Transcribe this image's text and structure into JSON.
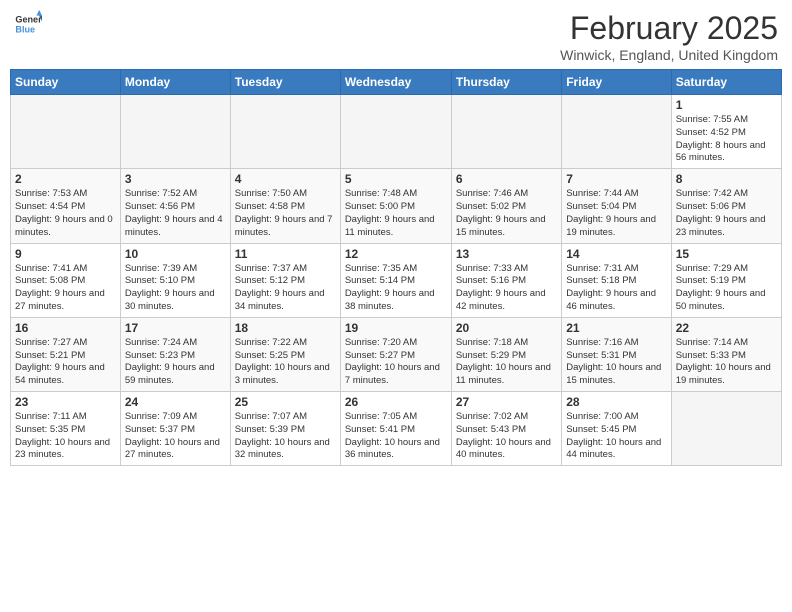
{
  "header": {
    "logo_line1": "General",
    "logo_line2": "Blue",
    "month_year": "February 2025",
    "location": "Winwick, England, United Kingdom"
  },
  "weekdays": [
    "Sunday",
    "Monday",
    "Tuesday",
    "Wednesday",
    "Thursday",
    "Friday",
    "Saturday"
  ],
  "weeks": [
    [
      {
        "day": "",
        "info": ""
      },
      {
        "day": "",
        "info": ""
      },
      {
        "day": "",
        "info": ""
      },
      {
        "day": "",
        "info": ""
      },
      {
        "day": "",
        "info": ""
      },
      {
        "day": "",
        "info": ""
      },
      {
        "day": "1",
        "info": "Sunrise: 7:55 AM\nSunset: 4:52 PM\nDaylight: 8 hours\nand 56 minutes."
      }
    ],
    [
      {
        "day": "2",
        "info": "Sunrise: 7:53 AM\nSunset: 4:54 PM\nDaylight: 9 hours\nand 0 minutes."
      },
      {
        "day": "3",
        "info": "Sunrise: 7:52 AM\nSunset: 4:56 PM\nDaylight: 9 hours\nand 4 minutes."
      },
      {
        "day": "4",
        "info": "Sunrise: 7:50 AM\nSunset: 4:58 PM\nDaylight: 9 hours\nand 7 minutes."
      },
      {
        "day": "5",
        "info": "Sunrise: 7:48 AM\nSunset: 5:00 PM\nDaylight: 9 hours\nand 11 minutes."
      },
      {
        "day": "6",
        "info": "Sunrise: 7:46 AM\nSunset: 5:02 PM\nDaylight: 9 hours\nand 15 minutes."
      },
      {
        "day": "7",
        "info": "Sunrise: 7:44 AM\nSunset: 5:04 PM\nDaylight: 9 hours\nand 19 minutes."
      },
      {
        "day": "8",
        "info": "Sunrise: 7:42 AM\nSunset: 5:06 PM\nDaylight: 9 hours\nand 23 minutes."
      }
    ],
    [
      {
        "day": "9",
        "info": "Sunrise: 7:41 AM\nSunset: 5:08 PM\nDaylight: 9 hours\nand 27 minutes."
      },
      {
        "day": "10",
        "info": "Sunrise: 7:39 AM\nSunset: 5:10 PM\nDaylight: 9 hours\nand 30 minutes."
      },
      {
        "day": "11",
        "info": "Sunrise: 7:37 AM\nSunset: 5:12 PM\nDaylight: 9 hours\nand 34 minutes."
      },
      {
        "day": "12",
        "info": "Sunrise: 7:35 AM\nSunset: 5:14 PM\nDaylight: 9 hours\nand 38 minutes."
      },
      {
        "day": "13",
        "info": "Sunrise: 7:33 AM\nSunset: 5:16 PM\nDaylight: 9 hours\nand 42 minutes."
      },
      {
        "day": "14",
        "info": "Sunrise: 7:31 AM\nSunset: 5:18 PM\nDaylight: 9 hours\nand 46 minutes."
      },
      {
        "day": "15",
        "info": "Sunrise: 7:29 AM\nSunset: 5:19 PM\nDaylight: 9 hours\nand 50 minutes."
      }
    ],
    [
      {
        "day": "16",
        "info": "Sunrise: 7:27 AM\nSunset: 5:21 PM\nDaylight: 9 hours\nand 54 minutes."
      },
      {
        "day": "17",
        "info": "Sunrise: 7:24 AM\nSunset: 5:23 PM\nDaylight: 9 hours\nand 59 minutes."
      },
      {
        "day": "18",
        "info": "Sunrise: 7:22 AM\nSunset: 5:25 PM\nDaylight: 10 hours\nand 3 minutes."
      },
      {
        "day": "19",
        "info": "Sunrise: 7:20 AM\nSunset: 5:27 PM\nDaylight: 10 hours\nand 7 minutes."
      },
      {
        "day": "20",
        "info": "Sunrise: 7:18 AM\nSunset: 5:29 PM\nDaylight: 10 hours\nand 11 minutes."
      },
      {
        "day": "21",
        "info": "Sunrise: 7:16 AM\nSunset: 5:31 PM\nDaylight: 10 hours\nand 15 minutes."
      },
      {
        "day": "22",
        "info": "Sunrise: 7:14 AM\nSunset: 5:33 PM\nDaylight: 10 hours\nand 19 minutes."
      }
    ],
    [
      {
        "day": "23",
        "info": "Sunrise: 7:11 AM\nSunset: 5:35 PM\nDaylight: 10 hours\nand 23 minutes."
      },
      {
        "day": "24",
        "info": "Sunrise: 7:09 AM\nSunset: 5:37 PM\nDaylight: 10 hours\nand 27 minutes."
      },
      {
        "day": "25",
        "info": "Sunrise: 7:07 AM\nSunset: 5:39 PM\nDaylight: 10 hours\nand 32 minutes."
      },
      {
        "day": "26",
        "info": "Sunrise: 7:05 AM\nSunset: 5:41 PM\nDaylight: 10 hours\nand 36 minutes."
      },
      {
        "day": "27",
        "info": "Sunrise: 7:02 AM\nSunset: 5:43 PM\nDaylight: 10 hours\nand 40 minutes."
      },
      {
        "day": "28",
        "info": "Sunrise: 7:00 AM\nSunset: 5:45 PM\nDaylight: 10 hours\nand 44 minutes."
      },
      {
        "day": "",
        "info": ""
      }
    ]
  ]
}
